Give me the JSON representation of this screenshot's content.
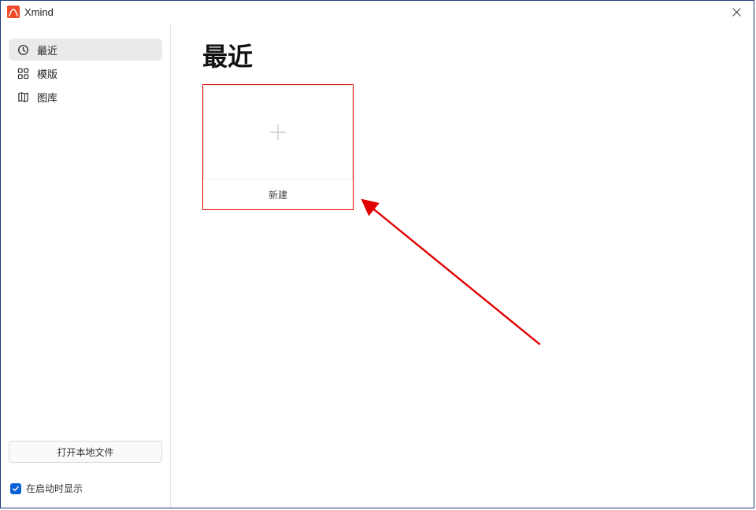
{
  "app": {
    "title": "Xmind"
  },
  "sidebar": {
    "items": [
      {
        "icon": "clock-icon",
        "label": "最近",
        "active": true
      },
      {
        "icon": "grid-icon",
        "label": "模版",
        "active": false
      },
      {
        "icon": "map-icon",
        "label": "图库",
        "active": false
      }
    ],
    "open_local_label": "打开本地文件",
    "startup_checkbox": {
      "checked": true,
      "label": "在启动时显示"
    }
  },
  "main": {
    "title": "最近",
    "cards": [
      {
        "kind": "new",
        "icon": "plus-icon",
        "caption": "新建",
        "highlighted": true
      }
    ]
  },
  "annotation": {
    "arrow_color": "#e10000"
  }
}
